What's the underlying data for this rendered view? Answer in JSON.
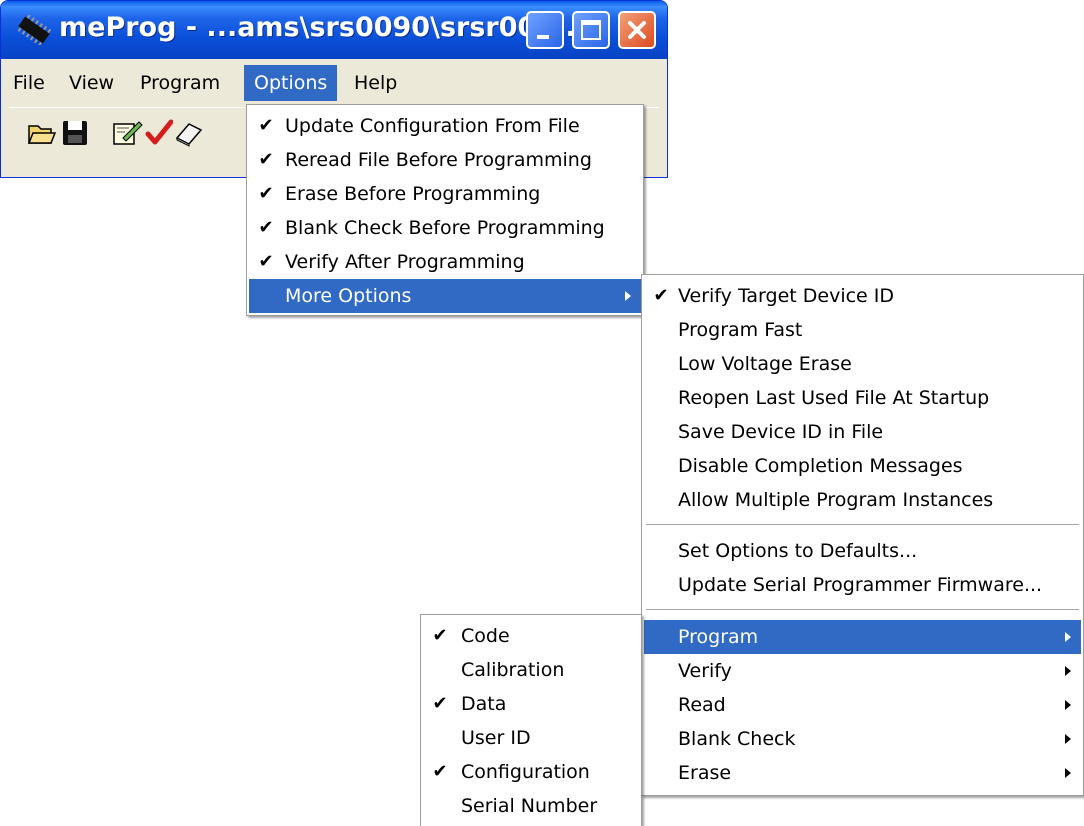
{
  "window": {
    "title": "meProg - ...ams\\srs0090\\srsr009..."
  },
  "menubar": {
    "items": [
      "File",
      "View",
      "Program",
      "Options",
      "Help"
    ]
  },
  "toolbar": {
    "icons": [
      "open-folder-icon",
      "save-icon",
      "edit-icon",
      "verify-check-icon",
      "erase-icon"
    ]
  },
  "options_menu": {
    "items": [
      {
        "label": "Update Configuration From File",
        "checked": true
      },
      {
        "label": "Reread File Before Programming",
        "checked": true
      },
      {
        "label": "Erase Before Programming",
        "checked": true
      },
      {
        "label": "Blank Check Before Programming",
        "checked": true
      },
      {
        "label": "Verify After Programming",
        "checked": true
      },
      {
        "label": "More Options",
        "checked": false,
        "submenu": true,
        "highlighted": true
      }
    ]
  },
  "more_options_menu": {
    "items": [
      {
        "label": "Verify Target Device ID",
        "checked": true
      },
      {
        "label": "Program Fast",
        "checked": false
      },
      {
        "label": "Low Voltage Erase",
        "checked": false
      },
      {
        "label": "Reopen Last Used File At Startup",
        "checked": false
      },
      {
        "label": "Save Device ID in File",
        "checked": false
      },
      {
        "label": "Disable Completion Messages",
        "checked": false
      },
      {
        "label": "Allow Multiple Program Instances",
        "checked": false
      },
      {
        "label": "Set Options to Defaults...",
        "checked": false
      },
      {
        "label": "Update Serial Programmer Firmware...",
        "checked": false
      },
      {
        "label": "Program",
        "submenu": true,
        "highlighted": true
      },
      {
        "label": "Verify",
        "submenu": true
      },
      {
        "label": "Read",
        "submenu": true
      },
      {
        "label": "Blank Check",
        "submenu": true
      },
      {
        "label": "Erase",
        "submenu": true
      }
    ]
  },
  "program_submenu": {
    "items": [
      {
        "label": "Code",
        "checked": true
      },
      {
        "label": "Calibration",
        "checked": false
      },
      {
        "label": "Data",
        "checked": true
      },
      {
        "label": "User ID",
        "checked": false
      },
      {
        "label": "Configuration",
        "checked": true
      },
      {
        "label": "Serial Number",
        "checked": false
      }
    ]
  },
  "check_glyph": "✔",
  "colors": {
    "highlight": "#316ac5",
    "menu_bg": "#ffffff",
    "window_bg": "#ece9d8",
    "titlebar": "#0a4fd8"
  }
}
